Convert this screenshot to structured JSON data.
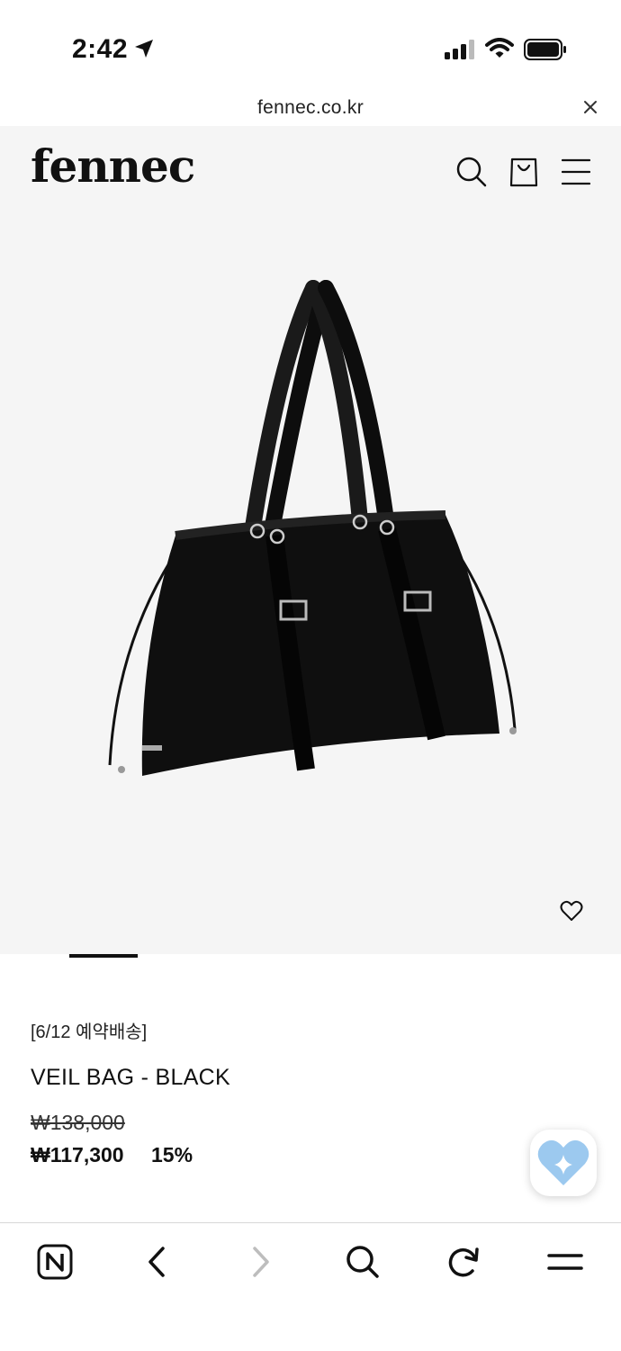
{
  "status_bar": {
    "time": "2:42"
  },
  "browser": {
    "url": "fennec.co.kr"
  },
  "site": {
    "logo": "fennec"
  },
  "product": {
    "pre_order": "[6/12 예약배송]",
    "name": "VEIL BAG - BLACK",
    "original_price": "₩138,000",
    "sale_price": "₩117,300",
    "discount": "15%"
  },
  "icons": {
    "status": [
      "location-arrow-icon",
      "signal-icon",
      "wifi-icon",
      "battery-icon"
    ],
    "header": [
      "search-icon",
      "shopping-bag-icon",
      "menu-icon"
    ],
    "product": [
      "heart-icon"
    ],
    "toolbar": [
      "naver-home-icon",
      "back-icon",
      "forward-icon",
      "search-icon",
      "reload-icon",
      "menu-icon"
    ]
  },
  "colors": {
    "text": "#111111",
    "image_bg": "#f5f5f5",
    "chat_heart": "#9cc9ef"
  }
}
